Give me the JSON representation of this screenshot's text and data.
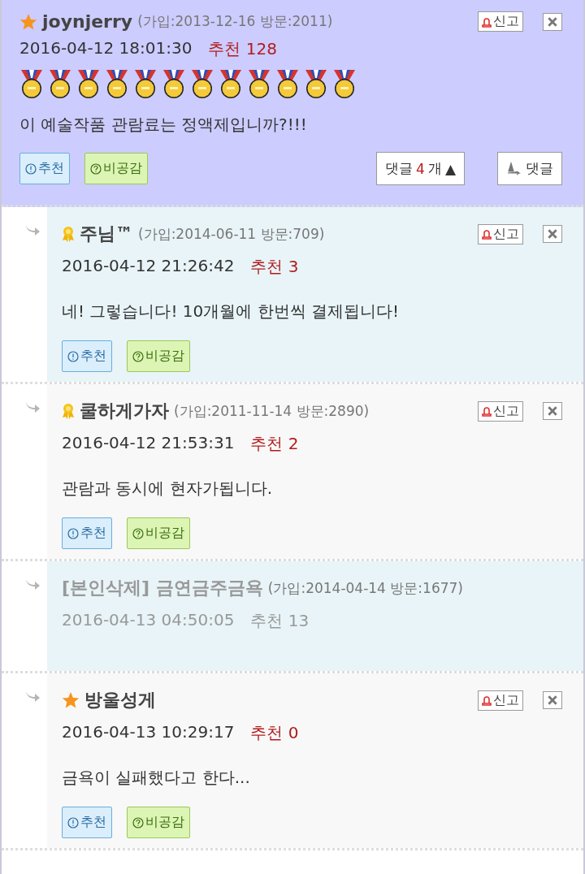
{
  "post": {
    "kind": "star",
    "author": "joynjerry",
    "meta": "(가입:2013-12-16 방문:2011)",
    "report": "신고",
    "datetime": "2016-04-12 18:01:30",
    "recommend": "추천 128",
    "medals": [
      {
        "kind": "gold"
      },
      {
        "kind": "gold"
      },
      {
        "kind": "gold"
      },
      {
        "kind": "gold"
      },
      {
        "kind": "gold"
      },
      {
        "kind": "gold"
      },
      {
        "kind": "gold"
      },
      {
        "kind": "gold"
      },
      {
        "kind": "gold"
      },
      {
        "kind": "gold"
      },
      {
        "kind": "gold"
      },
      {
        "kind": "gold"
      }
    ],
    "body": "이 예술작품 관람료는 정액제입니까?!!!",
    "upvote": "추천",
    "downvote": "비공감",
    "comments_toggle": {
      "label": "댓글",
      "count": "4",
      "unit": "개",
      "arrow": "▲",
      "expanded": true
    },
    "reply_button": "댓글"
  },
  "replies": [
    {
      "kind": "ribbon",
      "author": "주님™",
      "deleted": false,
      "highlighted": true,
      "meta": "(가입:2014-06-11 방문:709)",
      "report": "신고",
      "datetime": "2016-04-12 21:26:42",
      "recommend": "추천 3",
      "body": "네! 그렇습니다! 10개월에 한번씩 결제됩니다!",
      "upvote": "추천",
      "downvote": "비공감"
    },
    {
      "kind": "ribbon",
      "author": "쿨하게가자",
      "deleted": false,
      "highlighted": false,
      "meta": "(가입:2011-11-14 방문:2890)",
      "report": "신고",
      "datetime": "2016-04-12 21:53:31",
      "recommend": "추천 2",
      "body": "관람과 동시에 현자가됩니다.",
      "upvote": "추천",
      "downvote": "비공감"
    },
    {
      "kind": "plain",
      "author": "[본인삭제] 금연금주금욕",
      "deleted": true,
      "highlighted": true,
      "meta": "(가입:2014-04-14 방문:1677)",
      "datetime": "2016-04-13 04:50:05",
      "recommend": "추천 13"
    },
    {
      "kind": "star",
      "author": "방울성게",
      "deleted": false,
      "highlighted": false,
      "report": "신고",
      "datetime": "2016-04-13 10:29:17",
      "recommend": "추천 0",
      "body": "금욕이 실패했다고 한다...",
      "upvote": "추천",
      "downvote": "비공감"
    }
  ]
}
